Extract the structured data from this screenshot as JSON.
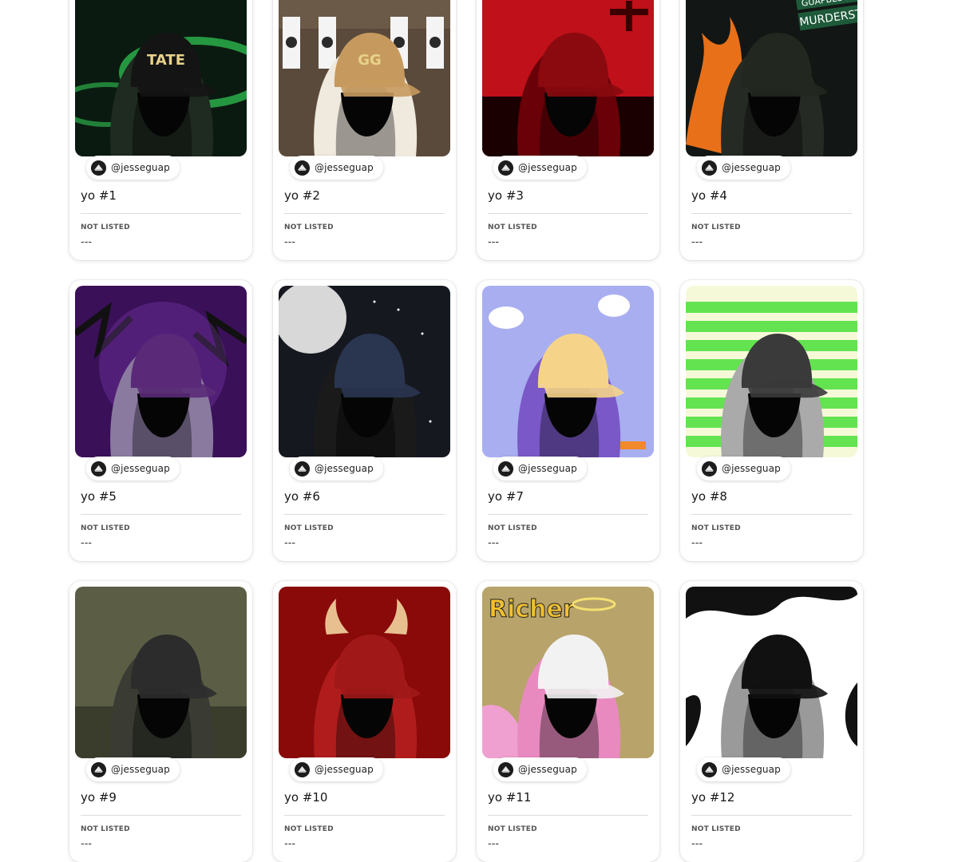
{
  "cards": [
    {
      "title": "yo #1",
      "creator": "@jesseguap",
      "status": "NOT LISTED",
      "price": "---",
      "bg": "#0b1a10",
      "accent": "#3dff6a",
      "hat": "#141414",
      "hood": "#1f2a20",
      "hat_text": "TATE"
    },
    {
      "title": "yo #2",
      "creator": "@jesseguap",
      "status": "NOT LISTED",
      "price": "---",
      "bg": "#5a4a3b",
      "accent": "#c8a070",
      "hat": "#c69a5e",
      "hood": "#efe9de",
      "hat_text": "GG"
    },
    {
      "title": "yo #3",
      "creator": "@jesseguap",
      "status": "NOT LISTED",
      "price": "---",
      "bg": "#c0101a",
      "accent": "#ff2a2a",
      "hat": "#8a0a10",
      "hood": "#6a0008",
      "hat_text": ""
    },
    {
      "title": "yo #4",
      "creator": "@jesseguap",
      "status": "NOT LISTED",
      "price": "---",
      "bg": "#121614",
      "accent": "#ff7a1a",
      "hat": "#22281f",
      "hood": "#262a24",
      "hat_text": "",
      "sign_top": "GUAPBLOCK",
      "sign_bottom": "MURDERST"
    },
    {
      "title": "yo #5",
      "creator": "@jesseguap",
      "status": "NOT LISTED",
      "price": "---",
      "bg": "#3a1058",
      "accent": "#9a4ad8",
      "hat": "#5a2a78",
      "hood": "#8a7aa0",
      "hat_text": ""
    },
    {
      "title": "yo #6",
      "creator": "@jesseguap",
      "status": "NOT LISTED",
      "price": "---",
      "bg": "#15181f",
      "accent": "#d8d8d8",
      "hat": "#2a3550",
      "hood": "#1a1a1a",
      "hat_text": ""
    },
    {
      "title": "yo #7",
      "creator": "@jesseguap",
      "status": "NOT LISTED",
      "price": "---",
      "bg": "#a8aef0",
      "accent": "#ffffff",
      "hat": "#f5d48a",
      "hood": "#7a58c8",
      "hat_text": ""
    },
    {
      "title": "yo #8",
      "creator": "@jesseguap",
      "status": "NOT LISTED",
      "price": "---",
      "bg": "#f6f9d8",
      "accent": "#4adf3a",
      "hat": "#3a3a3a",
      "hood": "#aaaaaa",
      "hat_text": ""
    },
    {
      "title": "yo #9",
      "creator": "@jesseguap",
      "status": "NOT LISTED",
      "price": "---",
      "bg": "#5b5e45",
      "accent": "#ff8a1a",
      "hat": "#2c2c2c",
      "hood": "#3a3c34",
      "hat_text": ""
    },
    {
      "title": "yo #10",
      "creator": "@jesseguap",
      "status": "NOT LISTED",
      "price": "---",
      "bg": "#8a0a0a",
      "accent": "#e8c090",
      "hat": "#a01818",
      "hood": "#b01c1c",
      "hat_text": ""
    },
    {
      "title": "yo #11",
      "creator": "@jesseguap",
      "status": "NOT LISTED",
      "price": "---",
      "bg": "#8a8a9a",
      "accent": "#f0a0d0",
      "hat": "#f2f2f2",
      "hood": "#e88ac0",
      "hat_text": "",
      "wall_text": "Richer"
    },
    {
      "title": "yo #12",
      "creator": "@jesseguap",
      "status": "NOT LISTED",
      "price": "---",
      "bg": "#ffffff",
      "accent": "#111111",
      "hat": "#111111",
      "hood": "#9a9a9a",
      "hat_text": ""
    }
  ]
}
